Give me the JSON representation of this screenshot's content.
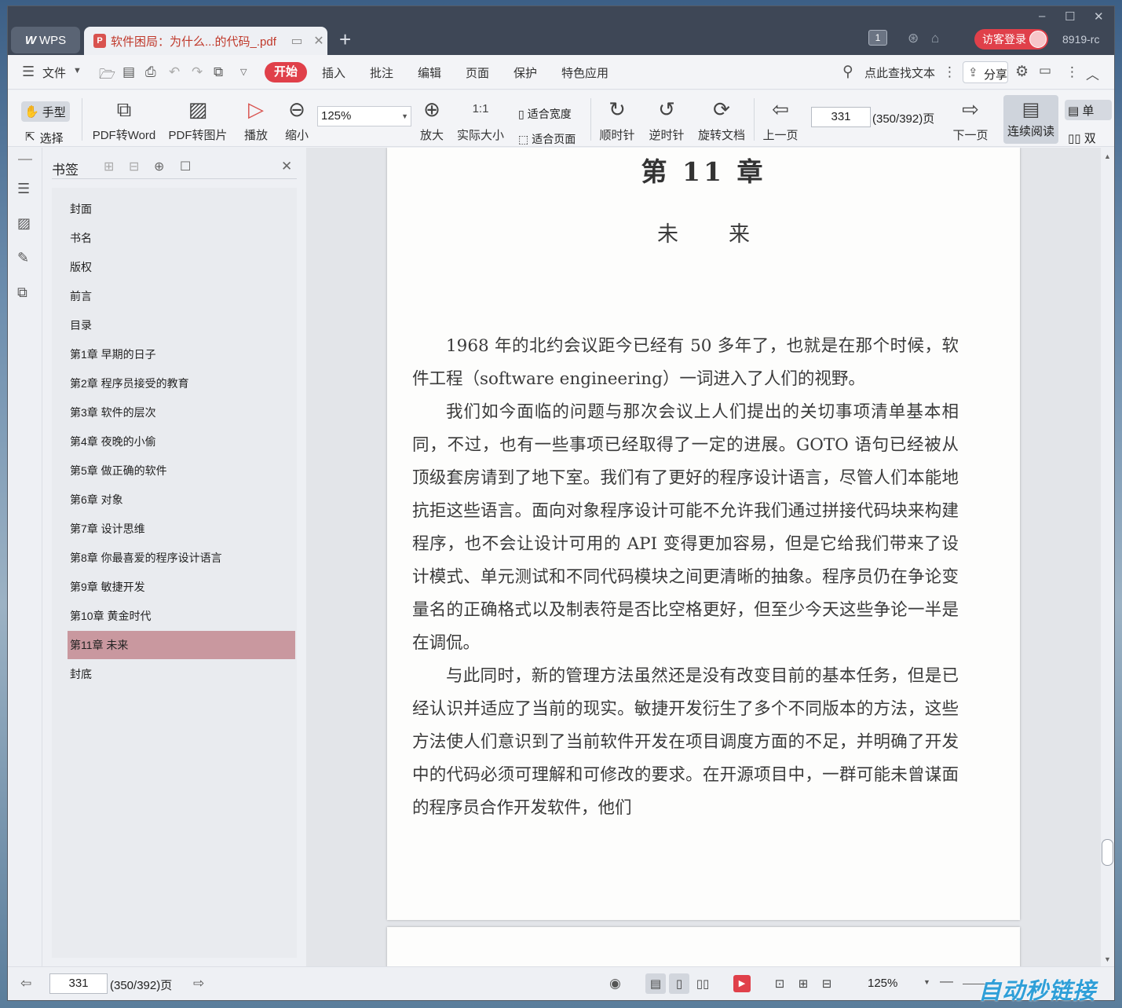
{
  "window": {
    "app_name": "WPS",
    "tab_title": "软件困局：为什么...的代码_.pdf",
    "new_tab": "+",
    "controls": [
      "–",
      "☐",
      "✕"
    ],
    "count_badge": "1",
    "guest_login": "访客登录",
    "user_id": "8919-rc"
  },
  "menu": {
    "file": "文件",
    "tabs": [
      "开始",
      "插入",
      "批注",
      "编辑",
      "页面",
      "保护",
      "特色应用"
    ],
    "search_text": "点此查找文本",
    "share": "分享"
  },
  "ribbon": {
    "hand": "手型",
    "select": "选择",
    "pdf_to_word": "PDF转Word",
    "pdf_to_image": "PDF转图片",
    "play": "播放",
    "zoom_out": "缩小",
    "zoom_value": "125%",
    "zoom_in": "放大",
    "actual_size": "实际大小",
    "fit_width": "适合宽度",
    "fit_page": "适合页面",
    "rotate_cw": "顺时针",
    "rotate_ccw": "逆时针",
    "rotate_doc": "旋转文档",
    "prev_page": "上一页",
    "page_input": "331",
    "page_total": "(350/392)页",
    "next_page": "下一页",
    "continuous_read": "连续阅读",
    "single": "单",
    "double": "双"
  },
  "bookmarks": {
    "title": "书签",
    "close": "✕",
    "items": [
      "封面",
      "书名",
      "版权",
      "前言",
      "目录",
      "第1章  早期的日子",
      "第2章  程序员接受的教育",
      "第3章  软件的层次",
      "第4章  夜晚的小偷",
      "第5章  做正确的软件",
      "第6章  对象",
      "第7章  设计思维",
      "第8章  你最喜爱的程序设计语言",
      "第9章  敏捷开发",
      "第10章  黄金时代",
      "第11章  未来",
      "封底"
    ],
    "active_index": 15
  },
  "page": {
    "chapter": "第 11 章",
    "subtitle": "未来",
    "paragraphs": [
      "1968 年的北约会议距今已经有 50 多年了，也就是在那个时候，软件工程（software engineering）一词进入了人们的视野。",
      "我们如今面临的问题与那次会议上人们提出的关切事项清单基本相同，不过，也有一些事项已经取得了一定的进展。GOTO 语句已经被从顶级套房请到了地下室。我们有了更好的程序设计语言，尽管人们本能地抗拒这些语言。面向对象程序设计可能不允许我们通过拼接代码块来构建程序，也不会让设计可用的 API 变得更加容易，但是它给我们带来了设计模式、单元测试和不同代码模块之间更清晰的抽象。程序员仍在争论变量名的正确格式以及制表符是否比空格更好，但至少今天这些争论一半是在调侃。",
      "与此同时，新的管理方法虽然还是没有改变目前的基本任务，但是已经认识并适应了当前的现实。敏捷开发衍生了多个不同版本的方法，这些方法使人们意识到了当前软件开发在项目调度方面的不足，并明确了开发中的代码必须可理解和可修改的要求。在开源项目中，一群可能未曾谋面的程序员合作开发软件，他们"
    ]
  },
  "status": {
    "page_input": "331",
    "page_total": "(350/392)页",
    "zoom": "125%"
  },
  "watermark": "自动秒链接",
  "colors": {
    "accent": "#e0404a",
    "active_bookmark": "#c9989f",
    "titlebar": "#3e4756"
  }
}
